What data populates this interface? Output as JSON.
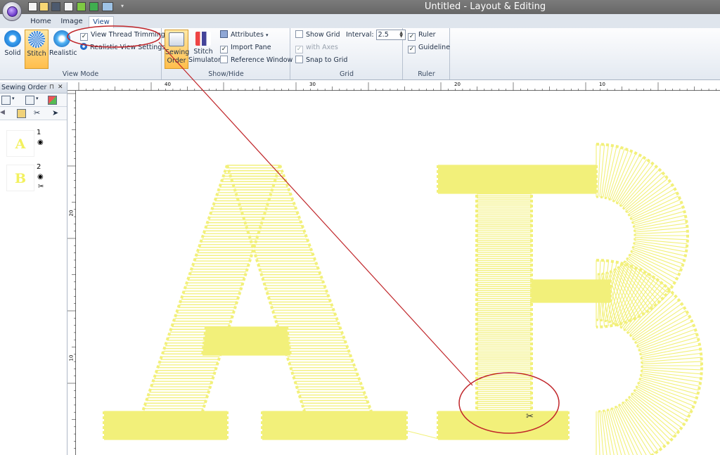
{
  "window": {
    "title": "Untitled - Layout & Editing"
  },
  "tabs": [
    {
      "label": "Home"
    },
    {
      "label": "Image"
    },
    {
      "label": "View"
    }
  ],
  "ribbon": {
    "view_mode": {
      "label": "View Mode",
      "solid": "Solid",
      "stitch": "Stitch",
      "realistic": "Realistic",
      "view_thread_trimming": "View Thread Trimming",
      "realistic_view_settings": "Realistic View Settings"
    },
    "show_hide": {
      "label": "Show/Hide",
      "sewing_order_1": "Sewing",
      "sewing_order_2": "Order",
      "stitch_sim_1": "Stitch",
      "stitch_sim_2": "Simulator",
      "attributes": "Attributes",
      "import_pane": "Import Pane",
      "reference_window": "Reference Window"
    },
    "grid": {
      "label": "Grid",
      "show_grid": "Show Grid",
      "interval_label": "Interval:",
      "interval_value": "2.5",
      "with_axes": "with Axes",
      "snap_to_grid": "Snap to Grid"
    },
    "ruler": {
      "label": "Ruler",
      "ruler": "Ruler",
      "guideline": "Guideline"
    }
  },
  "panel": {
    "title": "Sewing Order",
    "items": [
      {
        "number": "1",
        "letter": "A"
      },
      {
        "number": "2",
        "letter": "B"
      }
    ]
  },
  "rulers": {
    "top": [
      "40",
      "30",
      "20",
      "10"
    ],
    "left": [
      "20",
      "10"
    ]
  },
  "colors": {
    "stitch": "#f2f07a",
    "annotation": "#c0262a"
  }
}
